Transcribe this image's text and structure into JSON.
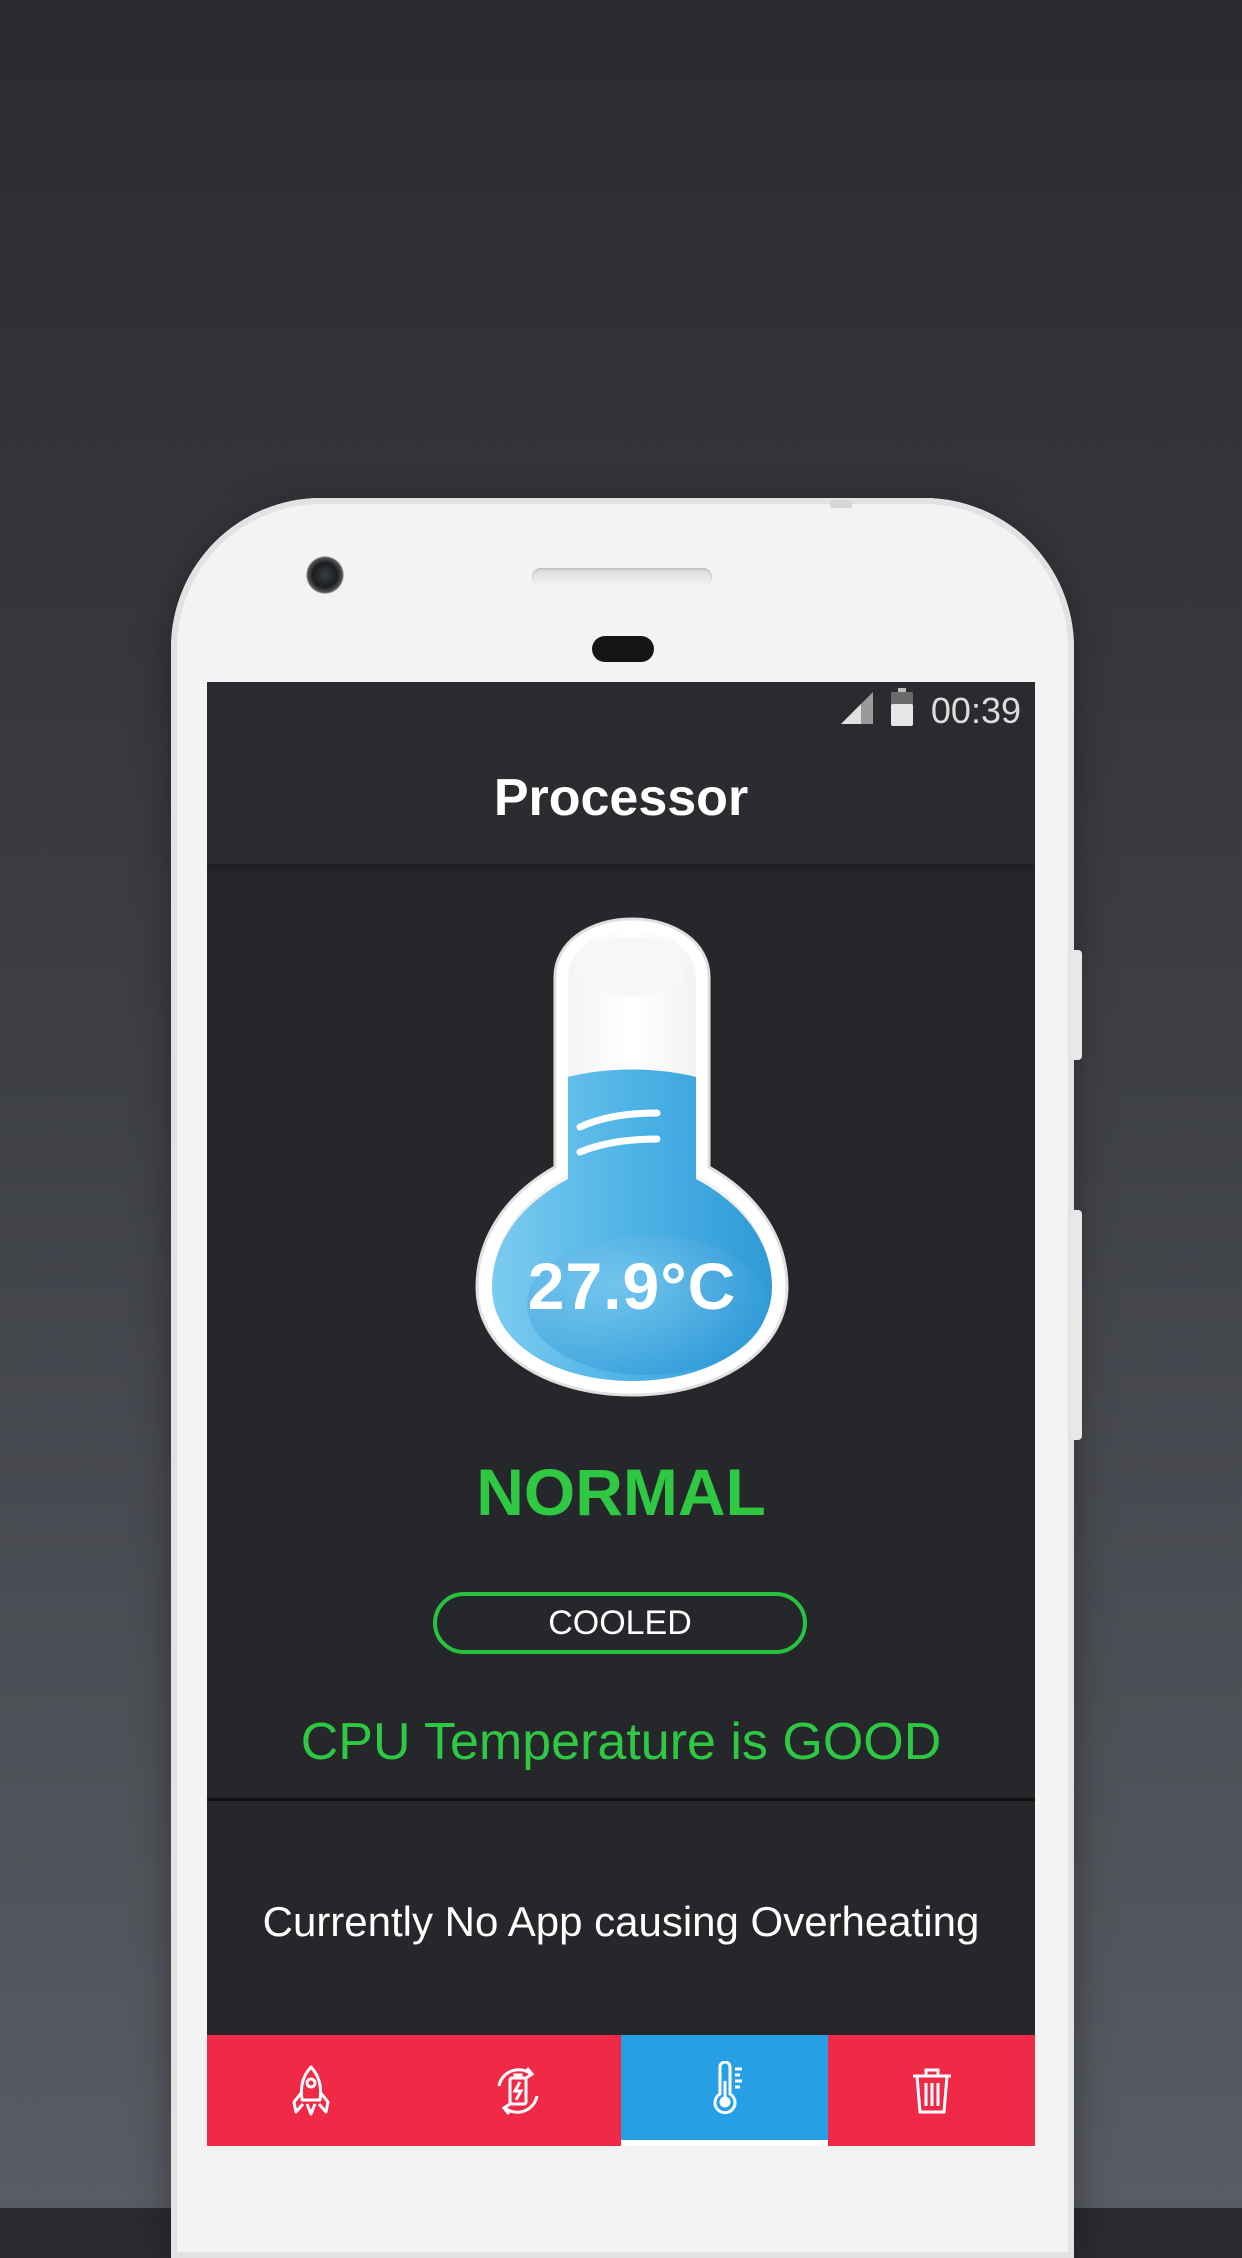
{
  "status_bar": {
    "time": "00:39",
    "signal_icon": "signal-icon",
    "battery_icon": "battery-icon"
  },
  "app_bar": {
    "title": "Processor"
  },
  "thermometer": {
    "temperature": "27.9°C",
    "fill_level": 0.75,
    "fill_color": "#4db3e6"
  },
  "status": {
    "label": "NORMAL",
    "badge": "COOLED",
    "message": "CPU Temperature is GOOD",
    "color": "#2ec843"
  },
  "apps_panel": {
    "message": "Currently No App causing Overheating"
  },
  "bottom_nav": {
    "tabs": [
      {
        "icon": "rocket-icon",
        "active": false
      },
      {
        "icon": "battery-refresh-icon",
        "active": false
      },
      {
        "icon": "thermometer-icon",
        "active": true
      },
      {
        "icon": "trash-icon",
        "active": false
      }
    ],
    "color": "#f02947",
    "active_color": "#279fe4"
  }
}
